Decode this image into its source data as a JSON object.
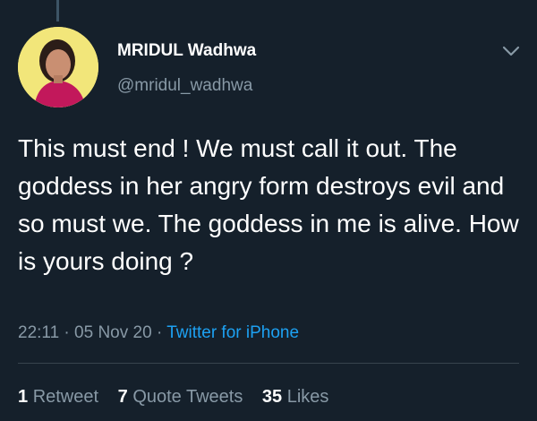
{
  "tweet": {
    "author": {
      "display_name": "MRIDUL Wadhwa",
      "handle": "@mridul_wadhwa",
      "avatar_bg_color": "#f2e67a"
    },
    "text": "This must end ! We must call it out. The goddess in her angry form destroys evil and so must we. The goddess in me is alive. How is yours doing ?",
    "time": "22:11",
    "separator": "·",
    "date": "05 Nov 20",
    "source": "Twitter for iPhone",
    "menu_icon": "chevron-down-icon"
  },
  "stats": {
    "retweets": {
      "count": "1",
      "label": "Retweet"
    },
    "quote_tweets": {
      "count": "7",
      "label": "Quote Tweets"
    },
    "likes": {
      "count": "35",
      "label": "Likes"
    }
  },
  "colors": {
    "background": "#15202b",
    "primary_text": "#ffffff",
    "secondary_text": "#8899a6",
    "link": "#1da1f2",
    "divider": "#38444d"
  }
}
